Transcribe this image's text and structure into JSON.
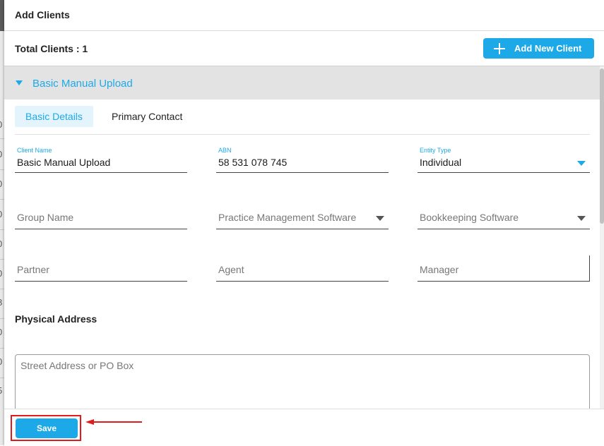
{
  "background": {
    "digits": [
      "0",
      "0",
      "0",
      "0",
      "0",
      "0",
      "8",
      "0",
      "0",
      "5"
    ]
  },
  "dialog": {
    "title": "Add Clients",
    "total_clients": "Total Clients : 1",
    "add_button": {
      "label": "Add New Client",
      "icon": "plus-icon"
    }
  },
  "accordion": {
    "label": "Basic Manual Upload",
    "icon": "caret-down-icon"
  },
  "tabs": [
    {
      "label": "Basic Details",
      "active": true
    },
    {
      "label": "Primary Contact",
      "active": false
    }
  ],
  "fields": {
    "client_name": {
      "label": "Client Name",
      "value": "Basic Manual Upload"
    },
    "abn": {
      "label": "ABN",
      "value": "58 531 078 745"
    },
    "entity_type": {
      "label": "Entity Type",
      "value": "Individual"
    },
    "group_name": {
      "placeholder": "Group Name"
    },
    "practice_management_software": {
      "placeholder": "Practice Management Software"
    },
    "bookkeeping_software": {
      "placeholder": "Bookkeeping Software"
    },
    "partner": {
      "placeholder": "Partner"
    },
    "agent": {
      "placeholder": "Agent"
    },
    "manager": {
      "placeholder": "Manager"
    }
  },
  "physical_address": {
    "title": "Physical Address",
    "street_placeholder": "Street Address or PO Box"
  },
  "footer": {
    "save_label": "Save"
  },
  "colors": {
    "accent": "#1da9e8",
    "annotation": "#e01b1b",
    "accordion_bg": "#e3e3e3"
  }
}
